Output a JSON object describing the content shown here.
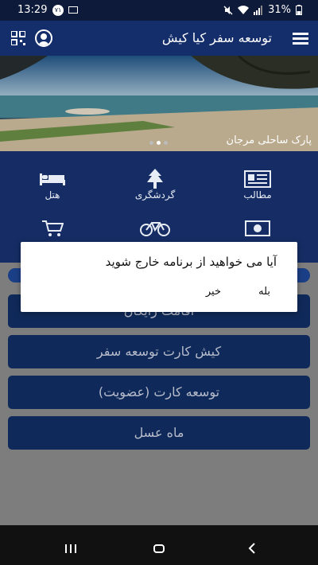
{
  "status_bar": {
    "time": "13:29",
    "notif_badge": "۷۱",
    "battery": "31%"
  },
  "header": {
    "title": "توسعه سفر کیا کیش"
  },
  "banner": {
    "caption": "پارک ساحلی مرجان",
    "slides": 3,
    "active_slide": 2
  },
  "categories": [
    {
      "label": "مطالب",
      "icon": "newspaper-icon"
    },
    {
      "label": "گردشگری",
      "icon": "tree-icon"
    },
    {
      "label": "هتل",
      "icon": "bed-icon"
    },
    {
      "label": "",
      "icon": "money-icon"
    },
    {
      "label": "",
      "icon": "bicycle-icon"
    },
    {
      "label": "",
      "icon": "cart-icon"
    }
  ],
  "menu_buttons": [
    "اقامت رایگان",
    "کیش کارت توسعه سفر",
    "توسعه کارت (عضویت)",
    "ماه عسل"
  ],
  "dialog": {
    "message": "آیا می خواهید از برنامه خارج شوید",
    "yes": "بله",
    "no": "خیر"
  },
  "colors": {
    "app_bar": "#132e6b",
    "grid_bg": "#152d64",
    "button": "#0f2a5a",
    "overlay": "#7d7d7d",
    "dialog": "#ffffff"
  }
}
